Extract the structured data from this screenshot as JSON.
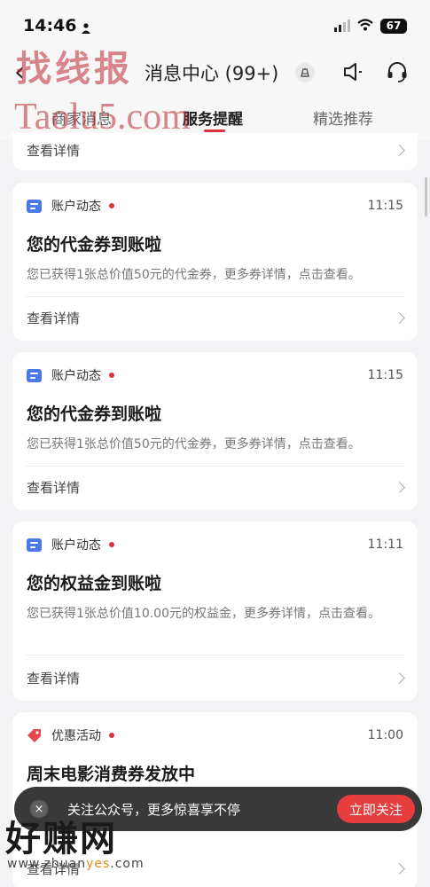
{
  "status": {
    "time": "14:46",
    "battery": "67"
  },
  "header": {
    "title": "消息中心 (99+)"
  },
  "watermarks": {
    "top_text": "找线报",
    "top_url": "Taolu5.com",
    "bottom_text": "好赚网",
    "bottom_url_pre": "www.zhuan",
    "bottom_url_hl": "yes",
    "bottom_url_post": ".com"
  },
  "tabs": [
    {
      "label": "商家消息"
    },
    {
      "label": "服务提醒"
    },
    {
      "label": "精选推荐"
    }
  ],
  "partial_card": {
    "detail_label": "查看详情"
  },
  "cards": [
    {
      "category": "账户动态",
      "time": "11:15",
      "title": "您的代金券到账啦",
      "body": "您已获得1张总价值50元的代金券，更多券详情，点击查看。",
      "detail_label": "查看详情"
    },
    {
      "category": "账户动态",
      "time": "11:15",
      "title": "您的代金券到账啦",
      "body": "您已获得1张总价值50元的代金券，更多券详情，点击查看。",
      "detail_label": "查看详情"
    },
    {
      "category": "账户动态",
      "time": "11:11",
      "title": "您的权益金到账啦",
      "body": "您已获得1张总价值10.00元的权益金，更多券详情，点击查看。",
      "detail_label": "查看详情"
    },
    {
      "category": "优惠活动",
      "time": "11:00",
      "title": "周末电影消费券发放中",
      "body": "",
      "detail_label": "查看详情"
    }
  ],
  "toast": {
    "close": "×",
    "text": "关注公众号，更多惊喜享不停",
    "button": "立即关注"
  },
  "colors": {
    "accent": "#e0303b",
    "category_icon": "#4c79e9",
    "tag_icon": "#e5484d"
  }
}
